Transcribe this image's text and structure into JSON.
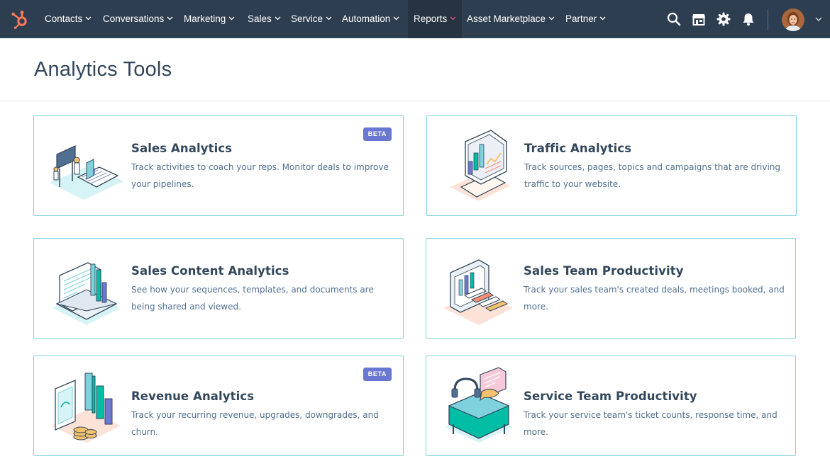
{
  "nav": {
    "items": [
      {
        "label": "Contacts"
      },
      {
        "label": "Conversations"
      },
      {
        "label": "Marketing"
      },
      {
        "label": "Sales"
      },
      {
        "label": "Service"
      },
      {
        "label": "Automation"
      },
      {
        "label": "Reports"
      },
      {
        "label": "Asset Marketplace"
      },
      {
        "label": "Partner"
      }
    ],
    "active": "Reports",
    "icons": [
      "search-icon",
      "marketplace-icon",
      "settings-icon",
      "notifications-icon"
    ]
  },
  "page": {
    "title": "Analytics Tools"
  },
  "cards": [
    {
      "title": "Sales Analytics",
      "description": "Track activities to coach your reps. Monitor deals to improve your pipelines.",
      "badge": "BETA",
      "icon": "sales-analytics-illustration"
    },
    {
      "title": "Traffic Analytics",
      "description": "Track sources, pages, topics and campaigns that are driving traffic to your website.",
      "icon": "traffic-analytics-illustration"
    },
    {
      "title": "Sales Content Analytics",
      "description": "See how your sequences, templates, and documents are being shared and viewed.",
      "icon": "sales-content-illustration"
    },
    {
      "title": "Sales Team Productivity",
      "description": "Track your sales team's created deals, meetings booked, and more.",
      "icon": "sales-team-illustration"
    },
    {
      "title": "Revenue Analytics",
      "description": "Track your recurring revenue, upgrades, downgrades, and churn.",
      "badge": "BETA",
      "icon": "revenue-analytics-illustration"
    },
    {
      "title": "Service Team Productivity",
      "description": "Track your service team's ticket counts, response time, and more.",
      "icon": "service-team-illustration"
    }
  ],
  "colors": {
    "nav_bg": "#2d3e50",
    "brand": "#ff7a59",
    "card_border": "#7fd1de",
    "badge": "#6a78d1",
    "active_accent": "#f2547d"
  }
}
